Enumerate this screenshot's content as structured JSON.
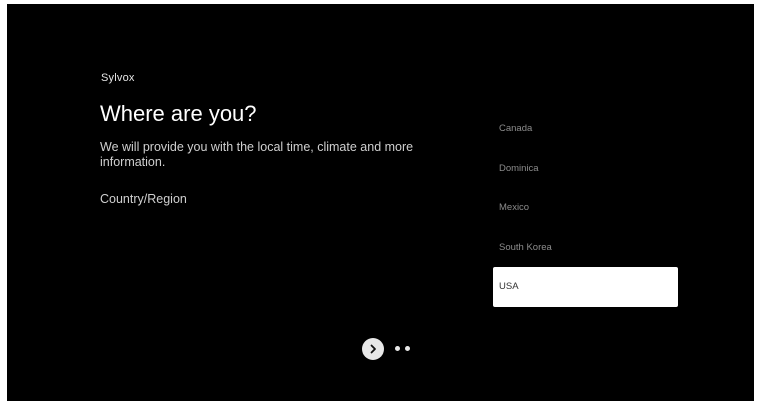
{
  "brand": {
    "name": "Sylvox"
  },
  "setup": {
    "title": "Where are you?",
    "subtitle": "We will provide you with the local time, climate and more information.",
    "field_label": "Country/Region",
    "countries": [
      {
        "label": "Canada",
        "selected": false
      },
      {
        "label": "Dominica",
        "selected": false
      },
      {
        "label": "Mexico",
        "selected": false
      },
      {
        "label": "South Korea",
        "selected": false
      },
      {
        "label": "USA",
        "selected": true
      }
    ],
    "selected_country": "USA",
    "pagination": {
      "steps": 3,
      "current": 1
    }
  },
  "icons": {
    "next": "chevron-right-icon"
  },
  "colors": {
    "background": "#000000",
    "text": "#ffffff",
    "muted_text": "#8c8c8c",
    "selection_bg": "#ffffff",
    "selection_text": "#333333"
  }
}
